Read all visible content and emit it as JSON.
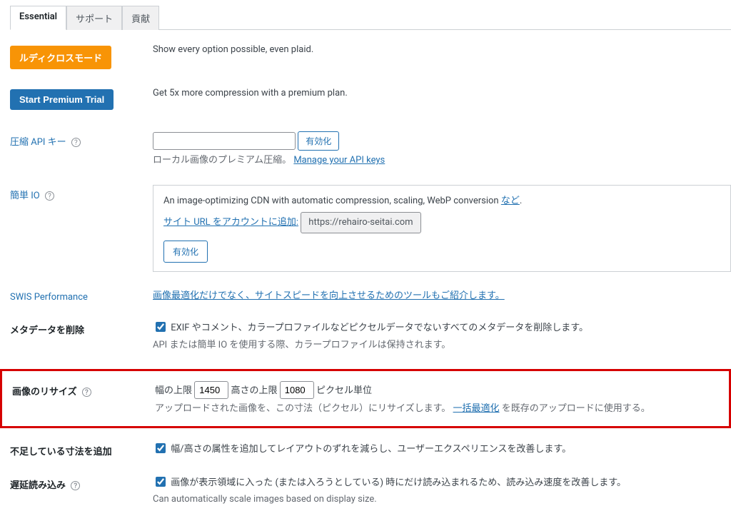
{
  "tabs": {
    "essential": "Essential",
    "support": "サポート",
    "contribute": "貢献"
  },
  "ludicrous": {
    "button": "ルディクロスモード",
    "desc": "Show every option possible, even plaid."
  },
  "premium": {
    "button": "Start Premium Trial",
    "desc": "Get 5x more compression with a premium plan."
  },
  "api": {
    "label": "圧縮 API キー",
    "activate": "有効化",
    "help": "ローカル画像のプレミアム圧縮。",
    "manage": "Manage your API keys"
  },
  "easyio": {
    "label": "簡単 IO",
    "desc1": "An image-optimizing CDN with automatic compression, scaling, WebP conversion ",
    "more": "など",
    "period": ".",
    "urlprompt": "サイト URL をアカウントに追加:",
    "urlvalue": "https://rehairo-seitai.com",
    "activate": "有効化"
  },
  "swis": {
    "label": "SWIS Performance",
    "link": "画像最適化だけでなく、サイトスピードを向上させるためのツールもご紹介します。"
  },
  "metadata": {
    "label": "メタデータを削除",
    "check": "EXIF やコメント、カラープロファイルなどピクセルデータでないすべてのメタデータを削除します。",
    "help": "API または簡単 IO を使用する際、カラープロファイルは保持されます。"
  },
  "resize": {
    "label": "画像のリサイズ",
    "widthlabel": "幅の上限",
    "width": "1450",
    "heightlabel": "高さの上限",
    "height": "1080",
    "unit": "ピクセル単位",
    "desc1": "アップロードされた画像を、この寸法（ピクセル）にリサイズします。",
    "bulk": "一括最適化",
    "desc2": "を既存のアップロードに使用する。"
  },
  "missing": {
    "label": "不足している寸法を追加",
    "check": "幅/高さの属性を追加してレイアウトのずれを減らし、ユーザーエクスペリエンスを改善します。"
  },
  "lazy": {
    "label": "遅延読み込み",
    "check": "画像が表示領域に入った (または入ろうとしている) 時にだけ読み込まれるため、読み込み速度を改善します。",
    "help": "Can automatically scale images based on display size."
  }
}
